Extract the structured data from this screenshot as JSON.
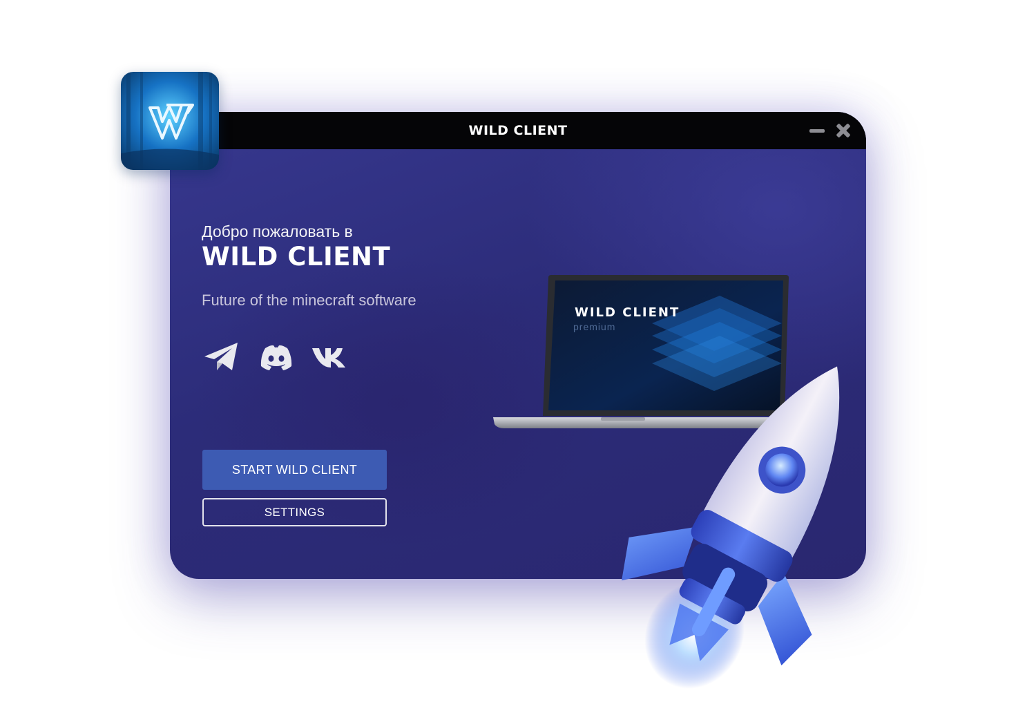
{
  "window": {
    "title": "WILD CLIENT",
    "controls": {
      "minimize_icon": "minus-icon",
      "close_icon": "close-icon"
    }
  },
  "hero": {
    "welcome": "Добро пожаловать в",
    "brand": "WILD CLIENT",
    "tagline": "Future of the minecraft software"
  },
  "socials": [
    {
      "name": "telegram",
      "icon": "telegram-icon"
    },
    {
      "name": "discord",
      "icon": "discord-icon"
    },
    {
      "name": "vk",
      "icon": "vk-icon"
    }
  ],
  "buttons": {
    "start": "START WILD CLIENT",
    "settings": "SETTINGS"
  },
  "laptop_screen": {
    "title": "WILD CLIENT",
    "subtitle": "premium"
  },
  "colors": {
    "accent": "#3d5bb3",
    "background": "#2c2c79",
    "titlebar": "#050507"
  }
}
